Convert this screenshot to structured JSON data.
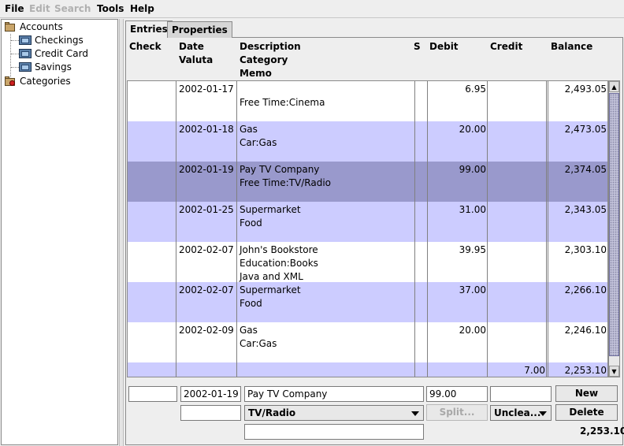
{
  "menu": {
    "file": "File",
    "edit": "Edit",
    "search": "Search",
    "tools": "Tools",
    "help": "Help"
  },
  "tree": {
    "accounts_label": "Accounts",
    "accounts": [
      {
        "label": "Checkings"
      },
      {
        "label": "Credit Card"
      },
      {
        "label": "Savings"
      }
    ],
    "categories_label": "Categories"
  },
  "tabs": {
    "entries": "Entries",
    "properties": "Properties"
  },
  "columns": {
    "check": "Check",
    "date": "Date",
    "valuta": "Valuta",
    "description": "Description",
    "category": "Category",
    "memo": "Memo",
    "status": "S",
    "debit": "Debit",
    "credit": "Credit",
    "balance": "Balance"
  },
  "rows": [
    {
      "date": "2002-01-17",
      "description": "",
      "category": "Free Time:Cinema",
      "memo": "",
      "debit": "6.95",
      "credit": "",
      "balance": "2,493.05",
      "style": "white"
    },
    {
      "date": "2002-01-18",
      "description": "Gas",
      "category": "Car:Gas",
      "memo": "",
      "debit": "20.00",
      "credit": "",
      "balance": "2,473.05",
      "style": "lav"
    },
    {
      "date": "2002-01-19",
      "description": "Pay TV Company",
      "category": "Free Time:TV/Radio",
      "memo": "",
      "debit": "99.00",
      "credit": "",
      "balance": "2,374.05",
      "style": "sel"
    },
    {
      "date": "2002-01-25",
      "description": "Supermarket",
      "category": "Food",
      "memo": "",
      "debit": "31.00",
      "credit": "",
      "balance": "2,343.05",
      "style": "lav"
    },
    {
      "date": "2002-02-07",
      "description": "John's Bookstore",
      "category": "Education:Books",
      "memo": "Java and XML",
      "debit": "39.95",
      "credit": "",
      "balance": "2,303.10",
      "style": "white"
    },
    {
      "date": "2002-02-07",
      "description": "Supermarket",
      "category": "Food",
      "memo": "",
      "debit": "37.00",
      "credit": "",
      "balance": "2,266.10",
      "style": "lav"
    },
    {
      "date": "2002-02-09",
      "description": "Gas",
      "category": "Car:Gas",
      "memo": "",
      "debit": "20.00",
      "credit": "",
      "balance": "2,246.10",
      "style": "white"
    },
    {
      "date": "",
      "description": "",
      "category": "",
      "memo": "",
      "debit": "",
      "credit": "7.00",
      "balance": "2,253.10",
      "style": "lav"
    }
  ],
  "editor": {
    "check_value": "",
    "date_value": "2002-01-19",
    "valuta_value": "",
    "description_value": "Pay TV Company",
    "category_value": "TV/Radio",
    "memo_value": "",
    "debit_value": "99.00",
    "credit_value": "",
    "split_label": "Split...",
    "status_value": "Unclea...",
    "new_label": "New",
    "delete_label": "Delete",
    "total": "2,253.10"
  },
  "colors": {
    "row_white": "#ffffff",
    "row_lavender": "#ccccff",
    "row_selected": "#9999cc"
  }
}
